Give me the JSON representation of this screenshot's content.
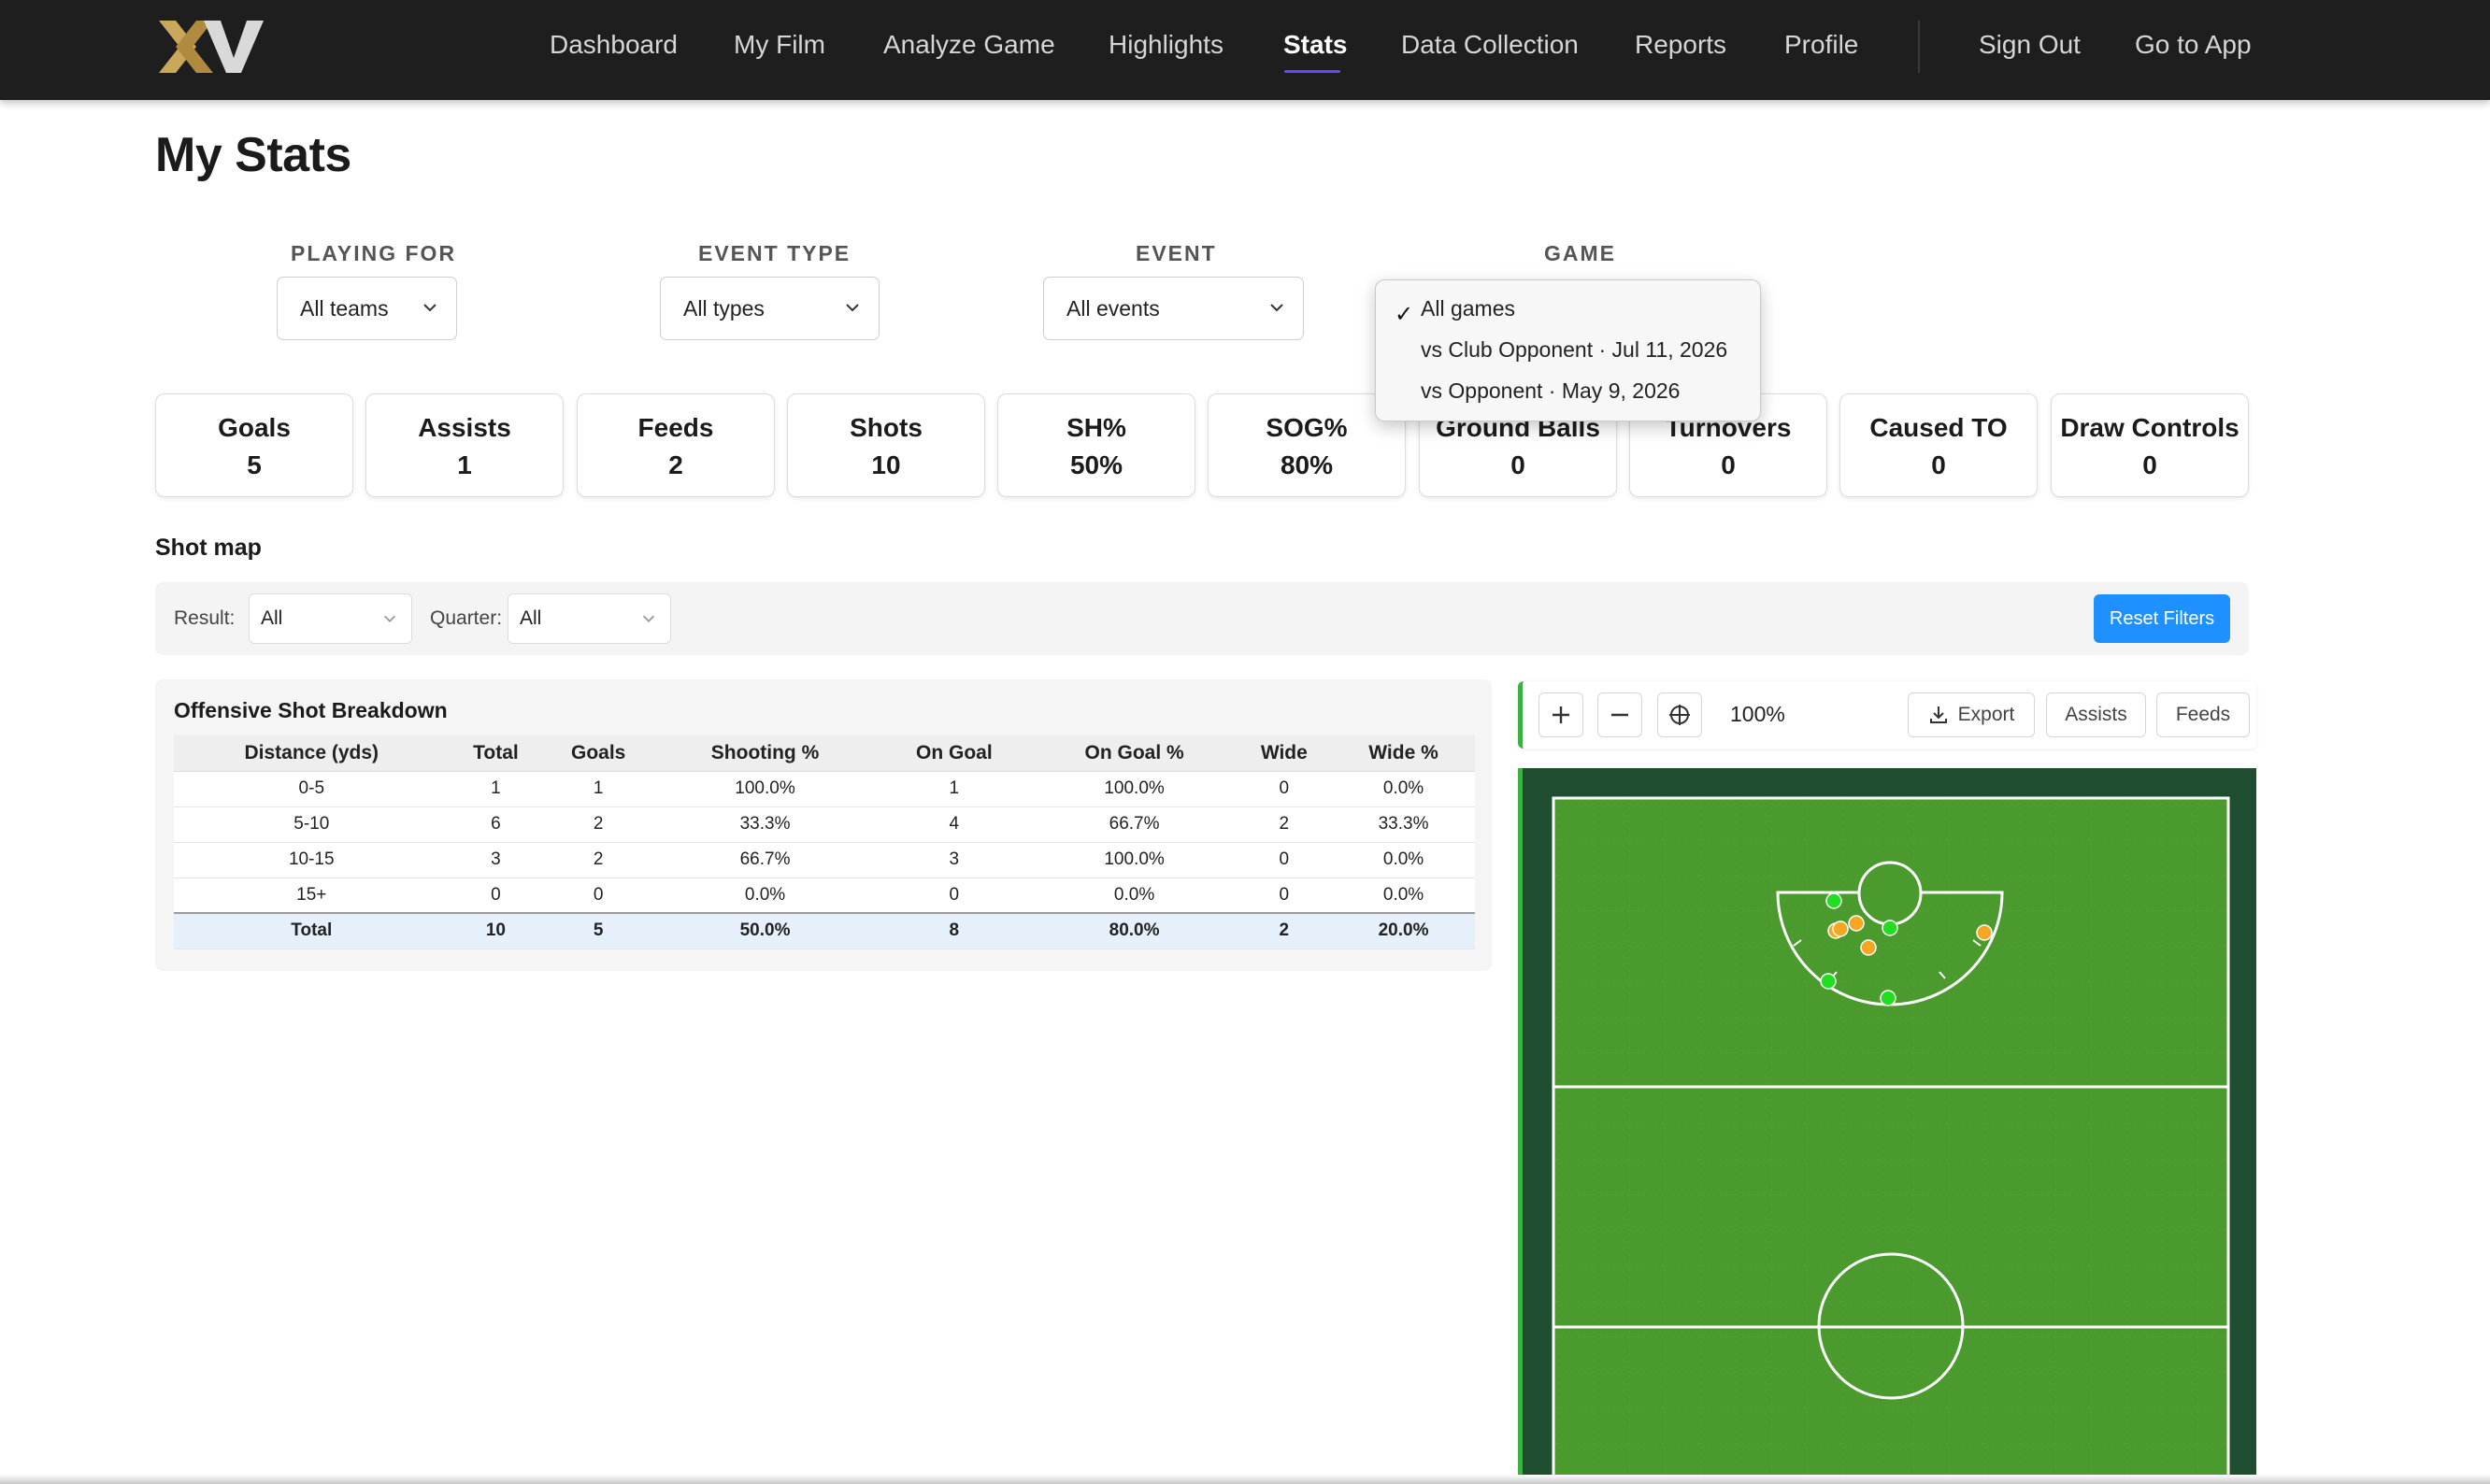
{
  "nav": {
    "items": [
      "Dashboard",
      "My Film",
      "Analyze Game",
      "Highlights",
      "Stats",
      "Data Collection",
      "Reports",
      "Profile"
    ],
    "active": "Stats",
    "sign_out": "Sign Out",
    "go_to_app": "Go to App",
    "logo_icon": "xv-logo",
    "accent": "#6b46ff"
  },
  "page": {
    "title": "My Stats"
  },
  "filters": {
    "playing_for": {
      "label": "PLAYING FOR",
      "value": "All teams"
    },
    "event_type": {
      "label": "EVENT TYPE",
      "value": "All types"
    },
    "event": {
      "label": "EVENT",
      "value": "All events"
    },
    "game": {
      "label": "GAME",
      "options": [
        "All games",
        "vs Club Opponent · Jul 11, 2026",
        "vs Opponent · May 9, 2026"
      ],
      "selected": "All games",
      "check_icon": "checkmark-icon"
    }
  },
  "stats": [
    {
      "label": "Goals",
      "value": "5"
    },
    {
      "label": "Assists",
      "value": "1"
    },
    {
      "label": "Feeds",
      "value": "2"
    },
    {
      "label": "Shots",
      "value": "10"
    },
    {
      "label": "SH%",
      "value": "50%"
    },
    {
      "label": "SOG%",
      "value": "80%"
    },
    {
      "label": "Ground Balls",
      "value": "0"
    },
    {
      "label": "Turnovers",
      "value": "0"
    },
    {
      "label": "Caused TO",
      "value": "0"
    },
    {
      "label": "Draw Controls",
      "value": "0"
    }
  ],
  "shot_map": {
    "title": "Shot map",
    "result_label": "Result:",
    "result_value": "All",
    "quarter_label": "Quarter:",
    "quarter_value": "All",
    "reset_label": "Reset Filters",
    "reset_color": "#1e90ff"
  },
  "breakdown": {
    "title": "Offensive Shot Breakdown",
    "columns": [
      "Distance (yds)",
      "Total",
      "Goals",
      "Shooting %",
      "On Goal",
      "On Goal %",
      "Wide",
      "Wide %"
    ],
    "rows": [
      [
        "0-5",
        "1",
        "1",
        "100.0%",
        "1",
        "100.0%",
        "0",
        "0.0%"
      ],
      [
        "5-10",
        "6",
        "2",
        "33.3%",
        "4",
        "66.7%",
        "2",
        "33.3%"
      ],
      [
        "10-15",
        "3",
        "2",
        "66.7%",
        "3",
        "100.0%",
        "0",
        "0.0%"
      ],
      [
        "15+",
        "0",
        "0",
        "0.0%",
        "0",
        "0.0%",
        "0",
        "0.0%"
      ]
    ],
    "total": [
      "Total",
      "10",
      "5",
      "50.0%",
      "8",
      "80.0%",
      "2",
      "20.0%"
    ]
  },
  "map_toolbar": {
    "zoom_in_icon": "plus-icon",
    "zoom_out_icon": "minus-icon",
    "recenter_icon": "crosshair-icon",
    "zoom": "100%",
    "export_icon": "download-icon",
    "export_label": "Export",
    "assists_label": "Assists",
    "feeds_label": "Feeds"
  },
  "field": {
    "grass_color": "#4a9a2e",
    "border_color": "#1f4d2f",
    "goal_color": "#22dd22",
    "save_color": "#f5a623"
  }
}
